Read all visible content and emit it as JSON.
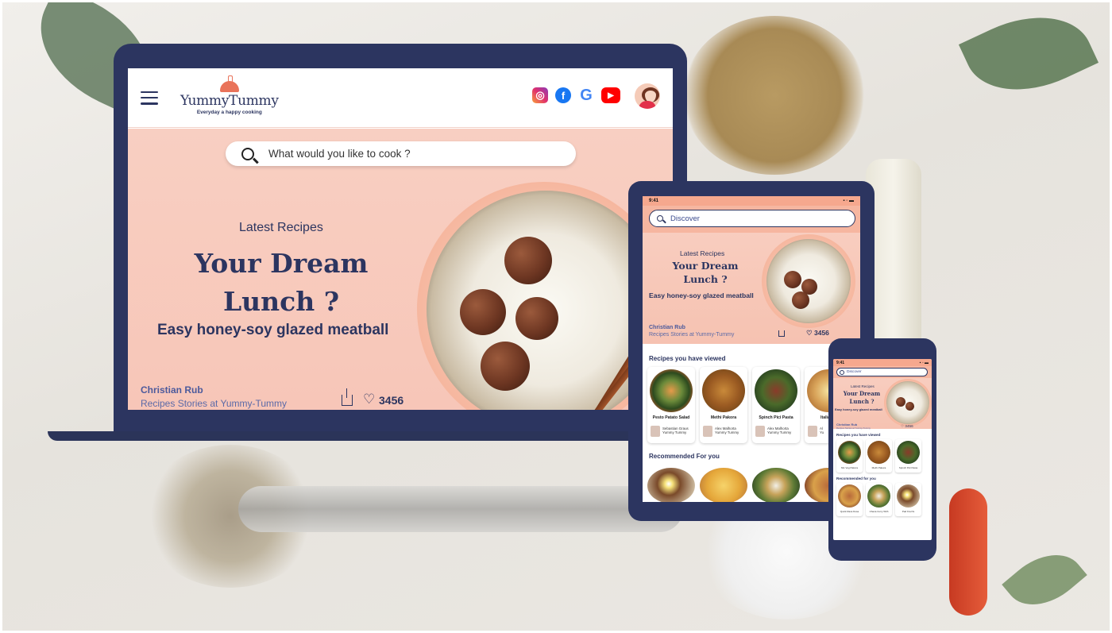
{
  "laptop": {
    "brand": {
      "name": "YummyTummy",
      "tagline": "Everyday a happy cooking"
    },
    "socials": [
      "instagram-icon",
      "facebook-icon",
      "google-icon",
      "youtube-icon"
    ],
    "search": {
      "placeholder": "What would you like to cook ?"
    },
    "hero": {
      "subtitle": "Latest Recipes",
      "title_line1": "Your Dream",
      "title_line2": "Lunch ?",
      "description": "Easy honey-soy glazed meatball",
      "author": "Christian Rub",
      "author_sub": "Recipes Stories at Yummy-Tummy",
      "likes": "3456"
    }
  },
  "tablet": {
    "time": "9:41",
    "search": {
      "placeholder": "Discover"
    },
    "hero": {
      "subtitle": "Latest Recipes",
      "title_line1": "Your Dream",
      "title_line2": "Lunch ?",
      "description": "Easy honey-soy glazed meatball",
      "author": "Christian Rub",
      "author_sub": "Recipes Stories at Yummy-Tummy",
      "likes": "3456"
    },
    "viewed_title": "Recipes you have viewed",
    "viewed": [
      {
        "name": "Pesto Patato Salad",
        "by": "Sebastian Graus",
        "by_sub": "Yummy Tummy"
      },
      {
        "name": "Methi Pakora",
        "by": "Alex Malhorta",
        "by_sub": "Yummy Tummy"
      },
      {
        "name": "Spinch Pici Pasta",
        "by": "Alex Malhorta",
        "by_sub": "Yummy Tummy"
      },
      {
        "name": "Italian P",
        "by": "Al",
        "by_sub": "Yu"
      }
    ],
    "recommended_title": "Recommended For you"
  },
  "phone": {
    "time": "9:41",
    "search": {
      "placeholder": "Discover"
    },
    "hero": {
      "subtitle": "Latest Recipes",
      "title_line1": "Your Dream",
      "title_line2": "Lunch ?",
      "description": "Easy honey-soy glazed meatball",
      "author": "Christian Rub",
      "author_sub": "Recipes Stories at Yummy-Tummy",
      "likes": "3456"
    },
    "viewed_title": "Recipes you have viewed",
    "viewed": [
      "Mix Veg Pakora",
      "Methi Pakora",
      "Spinch Pici Pasta"
    ],
    "recommended_title": "Recommended for you",
    "recommended": [
      "Quick Rava Dosa",
      "Chana Curry With",
      "Pad Kra Pa"
    ]
  },
  "colors": {
    "navy": "#2c3560",
    "peach": "#f8cfc2",
    "accent": "#e9735a"
  }
}
